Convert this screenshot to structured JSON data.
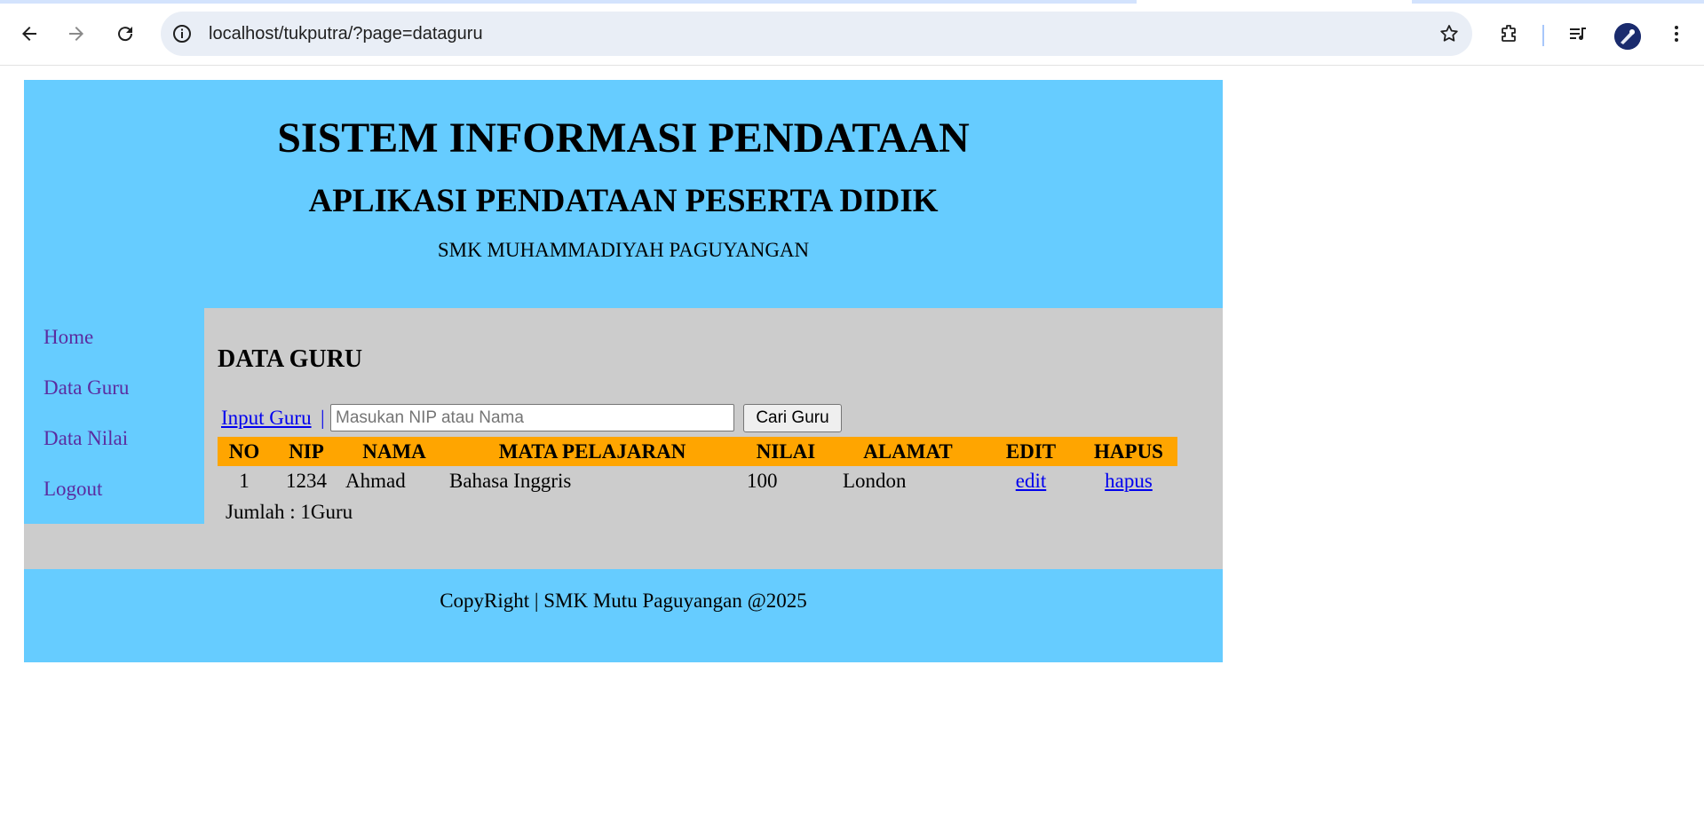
{
  "browser": {
    "url": "localhost/tukputra/?page=dataguru",
    "icons": [
      "back-arrow-icon",
      "forward-arrow-icon",
      "reload-icon",
      "site-info-icon",
      "bookmark-star-icon",
      "extensions-icon",
      "media-controls-icon",
      "profile-avatar",
      "more-menu-icon"
    ]
  },
  "header": {
    "title": "SISTEM INFORMASI PENDATAAN",
    "subtitle": "APLIKASI PENDATAAN PESERTA DIDIK",
    "school": "SMK MUHAMMADIYAH PAGUYANGAN"
  },
  "sidebar": {
    "items": [
      {
        "label": "Home"
      },
      {
        "label": "Data Guru"
      },
      {
        "label": "Data Nilai"
      },
      {
        "label": "Logout"
      }
    ]
  },
  "main": {
    "title": "DATA GURU",
    "input_link": "Input Guru ",
    "separator": "|",
    "search_placeholder": "Masukan NIP atau Nama",
    "search_button": "Cari Guru",
    "table": {
      "headers": [
        "NO",
        "NIP",
        "NAMA",
        "MATA PELAJARAN",
        "NILAI",
        "ALAMAT",
        "EDIT",
        "HAPUS"
      ],
      "rows": [
        {
          "no": "1",
          "nip": "1234",
          "nama": "Ahmad",
          "mapel": "Bahasa Inggris",
          "nilai": "100",
          "alamat": "London",
          "edit": "edit",
          "hapus": "hapus"
        }
      ]
    },
    "count": "Jumlah : 1Guru"
  },
  "footer": {
    "text": "CopyRight | SMK Mutu Paguyangan @2025"
  },
  "colors": {
    "header_bg": "#66ccff",
    "content_bg": "#cccccc",
    "table_header_bg": "#ffa500",
    "sidebar_link": "#5b2ca0",
    "link": "#0000ee"
  }
}
